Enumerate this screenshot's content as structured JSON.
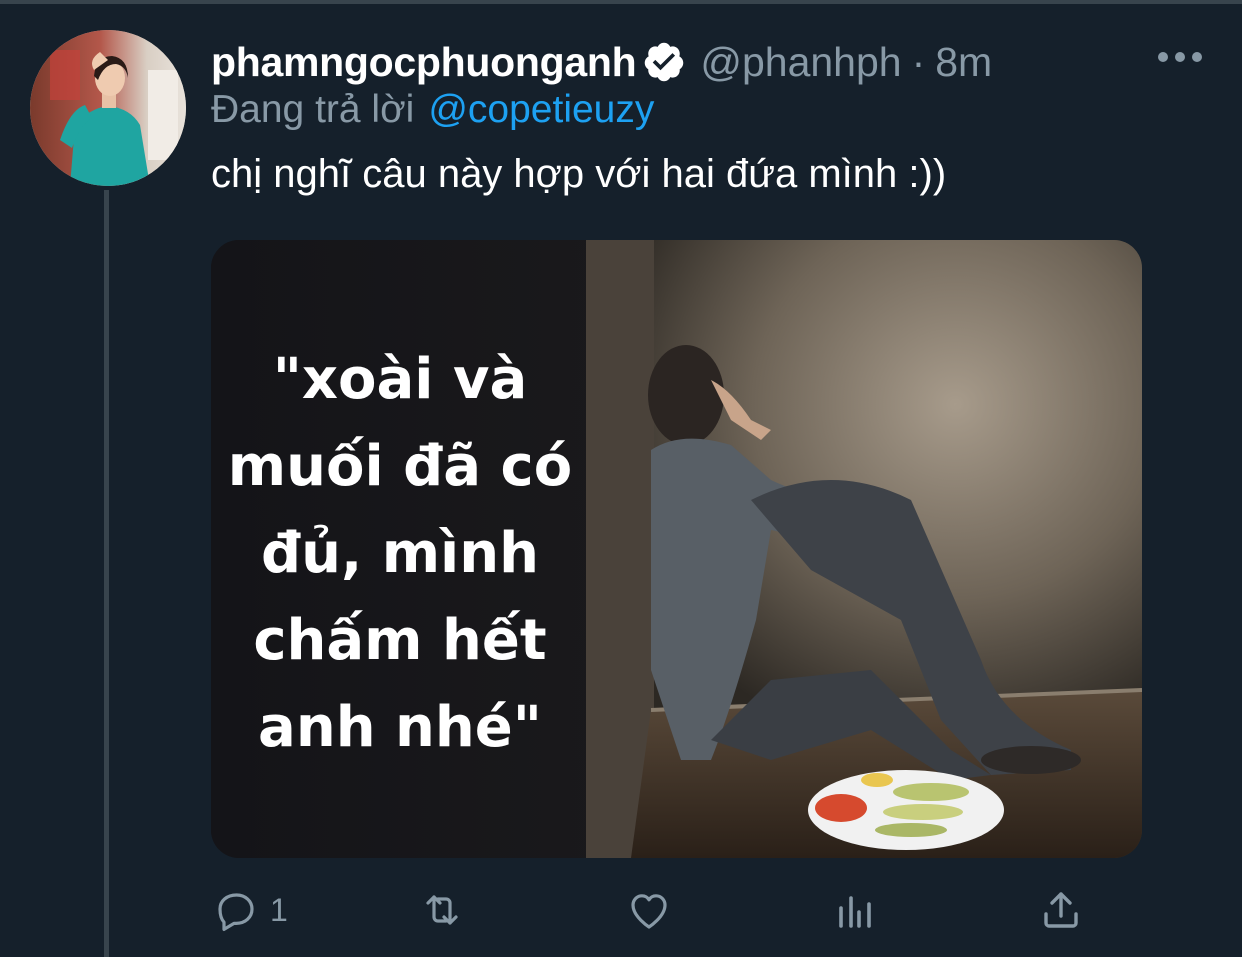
{
  "tweet": {
    "display_name": "phamngocphuonganh",
    "handle": "@phanhph",
    "separator": "·",
    "time": "8m",
    "reply_prefix": "Đang trả lời",
    "reply_to": "@copetieuzy",
    "text": "chị nghĩ câu này hợp với hai đứa mình :))",
    "media_caption_lines": [
      "\"xoài và",
      "muối đã có",
      "đủ, mình",
      "chấm hết",
      "anh nhé\""
    ],
    "reply_count": "1"
  },
  "icons": {
    "verified": "verified-badge-icon",
    "more": "more-options-icon",
    "reply": "reply-icon",
    "retweet": "retweet-icon",
    "like": "heart-icon",
    "analytics": "analytics-icon",
    "share": "share-icon"
  },
  "colors": {
    "background": "#15202b",
    "secondary_text": "#8899a6",
    "link": "#1da1f2",
    "divider": "#38444d"
  }
}
